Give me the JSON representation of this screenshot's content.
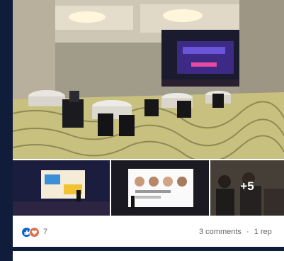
{
  "post": {
    "more_count": "+5",
    "reaction_count": "7",
    "comments_text": "3 comments",
    "separator": "·",
    "reposts_text": "1 rep"
  },
  "icons": {
    "like": "like-icon",
    "love": "heart-icon"
  },
  "colors": {
    "background": "#0f1d3a",
    "card": "#ffffff",
    "like": "#0a66c2",
    "love": "#df704d"
  }
}
